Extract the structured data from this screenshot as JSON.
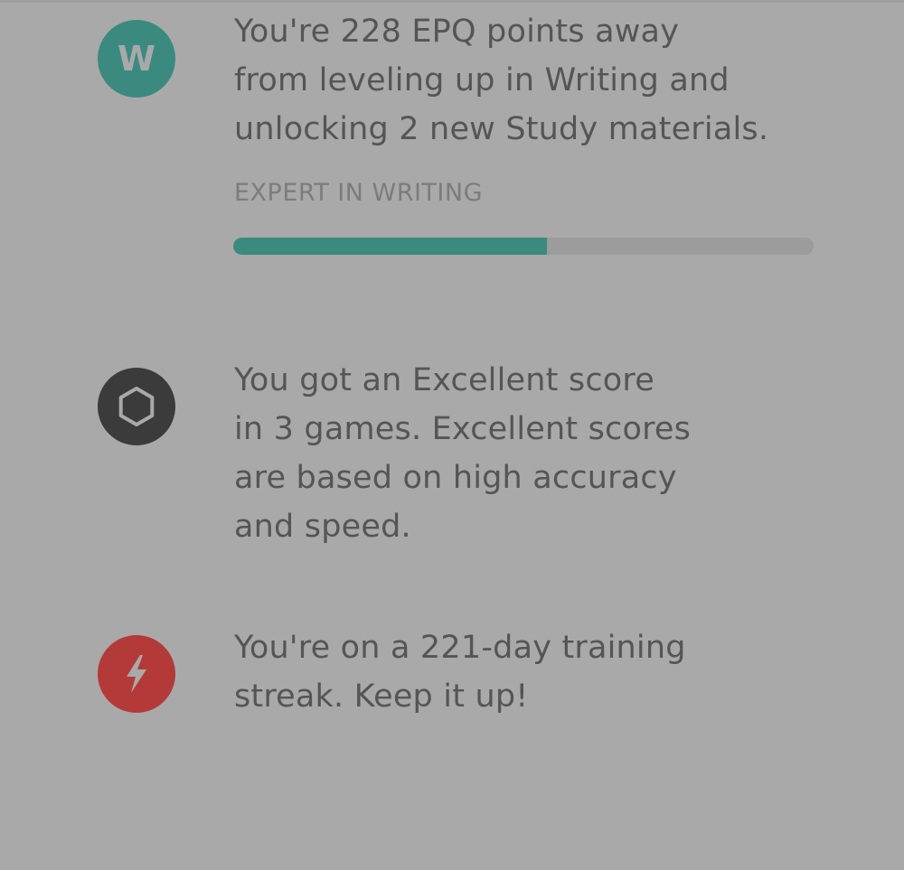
{
  "colors": {
    "background": "#a9a9a9",
    "writing_accent": "#3a8a80",
    "games_badge": "#3b3b3b",
    "streak_badge": "#b33a38",
    "body_text": "#555555",
    "muted_text": "#7c7c7c",
    "progress_track": "#9c9c9c"
  },
  "writing": {
    "badge_letter": "W",
    "message": "You're 228 EPQ points away\nfrom leveling up in Writing and\nunlocking 2 new Study materials.",
    "level_label": "EXPERT IN WRITING",
    "progress_fraction": 0.54
  },
  "games": {
    "icon": "hexagon-icon",
    "message": "You got an Excellent score\nin 3 games. Excellent scores\nare based on high accuracy\nand speed."
  },
  "streak": {
    "icon": "lightning-bolt-icon",
    "message": "You're on a 221-day training\nstreak. Keep it up!"
  }
}
